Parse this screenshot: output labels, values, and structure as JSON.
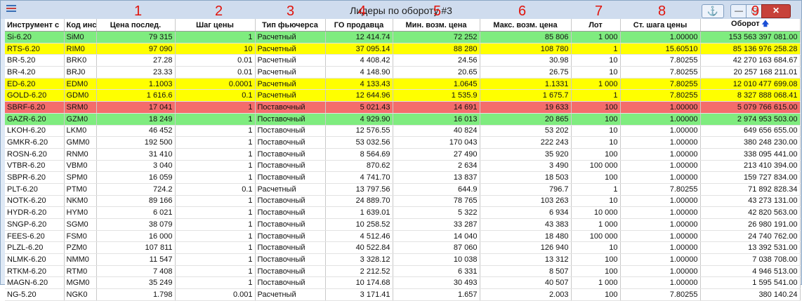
{
  "window": {
    "title": "Лидеры по обороту #3",
    "buttons": {
      "anchor": "⚓",
      "min": "—",
      "max": "□",
      "close": "✕"
    }
  },
  "overlay_numbers": [
    "1",
    "2",
    "3",
    "4",
    "5",
    "6",
    "7",
    "8",
    "9"
  ],
  "columns": [
    "Инструмент с",
    "Код инс",
    "Цена послед.",
    "Шаг цены",
    "Тип фьючерса",
    "ГО продавца",
    "Мин. возм. цена",
    "Макс. возм. цена",
    "Лот",
    "Ст. шага цены",
    "Оборот"
  ],
  "sort_indicator": "🡅",
  "colors": {
    "green": "#7fec7f",
    "yellow": "#ffff00",
    "red": "#f46c6c"
  },
  "rows": [
    {
      "hl": "green",
      "cells": [
        "Si-6.20",
        "SiM0",
        "79 315",
        "1",
        "Расчетный",
        "12 414.74",
        "72 252",
        "85 806",
        "1 000",
        "1.00000",
        "153 563 397 081.00"
      ]
    },
    {
      "hl": "yellow",
      "cells": [
        "RTS-6.20",
        "RIM0",
        "97 090",
        "10",
        "Расчетный",
        "37 095.14",
        "88 280",
        "108 780",
        "1",
        "15.60510",
        "85 136 976 258.28"
      ]
    },
    {
      "hl": "",
      "cells": [
        "BR-5.20",
        "BRK0",
        "27.28",
        "0.01",
        "Расчетный",
        "4 408.42",
        "24.56",
        "30.98",
        "10",
        "7.80255",
        "42 270 163 684.67"
      ]
    },
    {
      "hl": "",
      "cells": [
        "BR-4.20",
        "BRJ0",
        "23.33",
        "0.01",
        "Расчетный",
        "4 148.90",
        "20.65",
        "26.75",
        "10",
        "7.80255",
        "20 257 168 211.01"
      ]
    },
    {
      "hl": "yellow",
      "cells": [
        "ED-6.20",
        "EDM0",
        "1.1003",
        "0.0001",
        "Расчетный",
        "4 133.43",
        "1.0645",
        "1.1331",
        "1 000",
        "7.80255",
        "12 010 477 699.08"
      ]
    },
    {
      "hl": "yellow",
      "cells": [
        "GOLD-6.20",
        "GDM0",
        "1 616.6",
        "0.1",
        "Расчетный",
        "12 644.96",
        "1 535.9",
        "1 675.7",
        "1",
        "7.80255",
        "8 327 888 068.41"
      ]
    },
    {
      "hl": "red",
      "cells": [
        "SBRF-6.20",
        "SRM0",
        "17 041",
        "1",
        "Поставочный",
        "5 021.43",
        "14 691",
        "19 633",
        "100",
        "1.00000",
        "5 079 766 615.00"
      ]
    },
    {
      "hl": "green",
      "cells": [
        "GAZR-6.20",
        "GZM0",
        "18 249",
        "1",
        "Поставочный",
        "4 929.90",
        "16 013",
        "20 865",
        "100",
        "1.00000",
        "2 974 953 503.00"
      ]
    },
    {
      "hl": "",
      "cells": [
        "LKOH-6.20",
        "LKM0",
        "46 452",
        "1",
        "Поставочный",
        "12 576.55",
        "40 824",
        "53 202",
        "10",
        "1.00000",
        "649 656 655.00"
      ]
    },
    {
      "hl": "",
      "cells": [
        "GMKR-6.20",
        "GMM0",
        "192 500",
        "1",
        "Поставочный",
        "53 032.56",
        "170 043",
        "222 243",
        "10",
        "1.00000",
        "380 248 230.00"
      ]
    },
    {
      "hl": "",
      "cells": [
        "ROSN-6.20",
        "RNM0",
        "31 410",
        "1",
        "Поставочный",
        "8 564.69",
        "27 490",
        "35 920",
        "100",
        "1.00000",
        "338 095 441.00"
      ]
    },
    {
      "hl": "",
      "cells": [
        "VTBR-6.20",
        "VBM0",
        "3 040",
        "1",
        "Поставочный",
        "870.62",
        "2 634",
        "3 490",
        "100 000",
        "1.00000",
        "213 410 394.00"
      ]
    },
    {
      "hl": "",
      "cells": [
        "SBPR-6.20",
        "SPM0",
        "16 059",
        "1",
        "Поставочный",
        "4 741.70",
        "13 837",
        "18 503",
        "100",
        "1.00000",
        "159 727 834.00"
      ]
    },
    {
      "hl": "",
      "cells": [
        "PLT-6.20",
        "PTM0",
        "724.2",
        "0.1",
        "Расчетный",
        "13 797.56",
        "644.9",
        "796.7",
        "1",
        "7.80255",
        "71 892 828.34"
      ]
    },
    {
      "hl": "",
      "cells": [
        "NOTK-6.20",
        "NKM0",
        "89 166",
        "1",
        "Поставочный",
        "24 889.70",
        "78 765",
        "103 263",
        "10",
        "1.00000",
        "43 273 131.00"
      ]
    },
    {
      "hl": "",
      "cells": [
        "HYDR-6.20",
        "HYM0",
        "6 021",
        "1",
        "Поставочный",
        "1 639.01",
        "5 322",
        "6 934",
        "10 000",
        "1.00000",
        "42 820 563.00"
      ]
    },
    {
      "hl": "",
      "cells": [
        "SNGP-6.20",
        "SGM0",
        "38 079",
        "1",
        "Поставочный",
        "10 258.52",
        "33 287",
        "43 383",
        "1 000",
        "1.00000",
        "26 980 191.00"
      ]
    },
    {
      "hl": "",
      "cells": [
        "FEES-6.20",
        "FSM0",
        "16 000",
        "1",
        "Поставочный",
        "4 512.46",
        "14 040",
        "18 480",
        "100 000",
        "1.00000",
        "24 740 762.00"
      ]
    },
    {
      "hl": "",
      "cells": [
        "PLZL-6.20",
        "PZM0",
        "107 811",
        "1",
        "Поставочный",
        "40 522.84",
        "87 060",
        "126 940",
        "10",
        "1.00000",
        "13 392 531.00"
      ]
    },
    {
      "hl": "",
      "cells": [
        "NLMK-6.20",
        "NMM0",
        "11 547",
        "1",
        "Поставочный",
        "3 328.12",
        "10 038",
        "13 312",
        "100",
        "1.00000",
        "7 038 708.00"
      ]
    },
    {
      "hl": "",
      "cells": [
        "RTKM-6.20",
        "RTM0",
        "7 408",
        "1",
        "Поставочный",
        "2 212.52",
        "6 331",
        "8 507",
        "100",
        "1.00000",
        "4 946 513.00"
      ]
    },
    {
      "hl": "",
      "cells": [
        "MAGN-6.20",
        "MGM0",
        "35 249",
        "1",
        "Поставочный",
        "10 174.68",
        "30 493",
        "40 507",
        "1 000",
        "1.00000",
        "1 595 541.00"
      ]
    },
    {
      "hl": "",
      "cells": [
        "NG-5.20",
        "NGK0",
        "1.798",
        "0.001",
        "Расчетный",
        "3 171.41",
        "1.657",
        "2.003",
        "100",
        "7.80255",
        "380 140.24"
      ]
    }
  ]
}
